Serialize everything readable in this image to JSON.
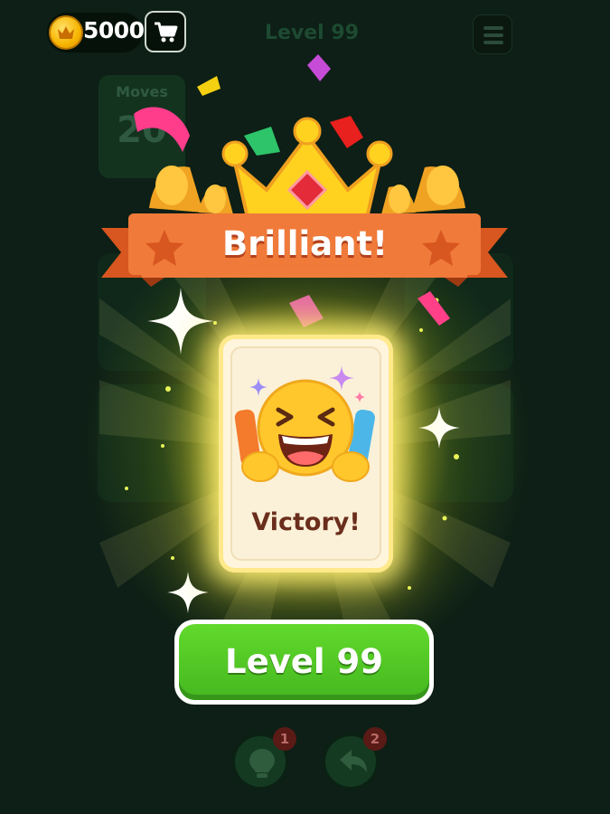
{
  "header": {
    "coins": "5000",
    "level_label": "Level 99",
    "coin_icon": "crown-coin-icon",
    "cart_icon": "shopping-cart-icon",
    "menu_icon": "hamburger-menu-icon"
  },
  "board": {
    "moves_label": "Moves",
    "moves_value": "20"
  },
  "result": {
    "banner_title": "Brilliant!",
    "card_caption": "Victory!",
    "card_icon": "laughing-face-emoji-icon"
  },
  "actions": {
    "next_level_label": "Level 99"
  },
  "tools": [
    {
      "icon": "lightbulb-hint-icon",
      "badge": "1"
    },
    {
      "icon": "undo-arrow-icon",
      "badge": "2"
    }
  ],
  "colors": {
    "background": "#0d1f16",
    "banner": "#f07a3a",
    "button_green": "#4cc425",
    "card": "#fff5dd",
    "coin_gold": "#f7b500"
  }
}
